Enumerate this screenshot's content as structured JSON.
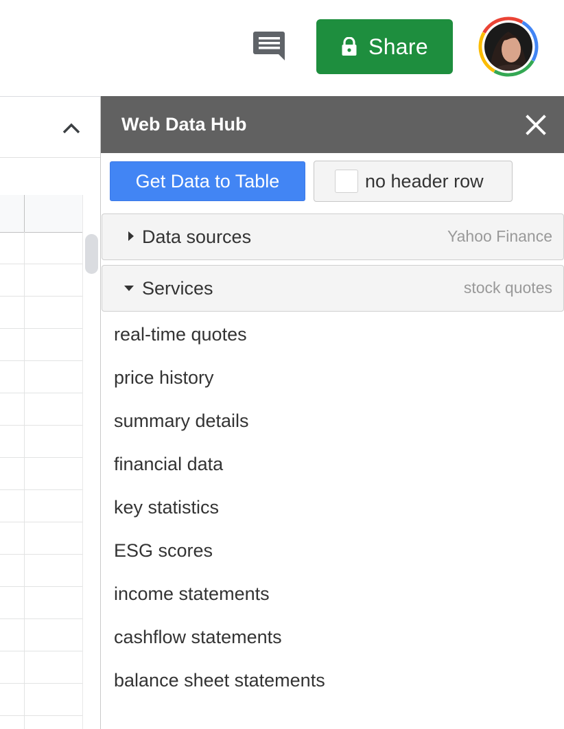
{
  "topbar": {
    "comment_icon": "comment-icon",
    "share": {
      "label": "Share",
      "icon": "lock-icon",
      "color": "#1e8e3e"
    },
    "avatar": {
      "icon": "user-avatar"
    }
  },
  "sheet": {
    "collapse_icon": "chevron-up-icon"
  },
  "sidebar": {
    "title": "Web Data Hub",
    "header_color": "#616161",
    "close_icon": "close-icon",
    "get_data_button": "Get Data to Table",
    "no_header_checkbox": {
      "label": "no header row",
      "checked": false
    },
    "data_sources": {
      "title": "Data sources",
      "selected": "Yahoo Finance",
      "expanded": false
    },
    "services": {
      "title": "Services",
      "selected": "stock quotes",
      "expanded": true,
      "items": [
        "real-time quotes",
        "price history",
        "summary details",
        "financial data",
        "key statistics",
        "ESG scores",
        "income statements",
        "cashflow statements",
        "balance sheet statements"
      ]
    }
  }
}
